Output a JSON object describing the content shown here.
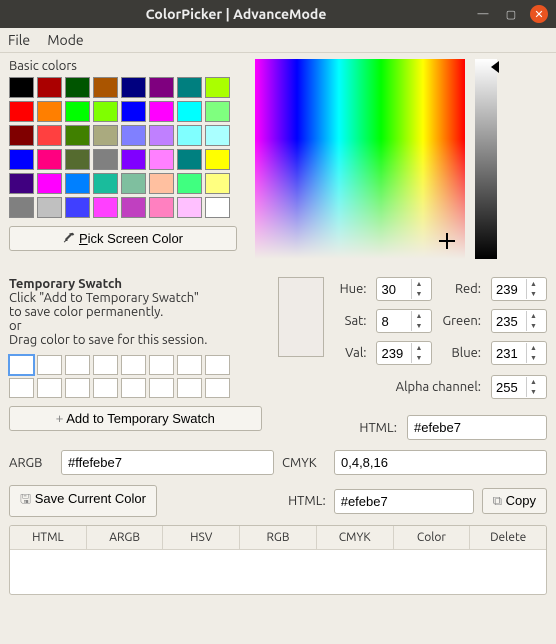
{
  "window": {
    "title": "ColorPicker | AdvanceMode"
  },
  "menu": {
    "file": "File",
    "mode": "Mode"
  },
  "basic_label": "Basic colors",
  "basic_colors": [
    "#000000",
    "#aa0000",
    "#005500",
    "#aa5500",
    "#00007f",
    "#7f007f",
    "#007f7f",
    "#aaff00",
    "#ff0000",
    "#ff7f00",
    "#00ff00",
    "#7fff00",
    "#0000ff",
    "#ff00ff",
    "#00ffff",
    "#7fff7f",
    "#800000",
    "#ff4040",
    "#408000",
    "#aaaa7f",
    "#8080ff",
    "#c080ff",
    "#80ffff",
    "#aaffff",
    "#0000ff",
    "#ff0080",
    "#556b2f",
    "#808080",
    "#8000ff",
    "#ff80ff",
    "#008080",
    "#ffff00",
    "#400080",
    "#ff00ff",
    "#0080ff",
    "#1abc9c",
    "#7fbf9f",
    "#ffc0a0",
    "#40ff80",
    "#ffff80",
    "#808080",
    "#c0c0c0",
    "#4040ff",
    "#ff40ff",
    "#c040c0",
    "#ff80c0",
    "#ffc0ff",
    "#ffffff"
  ],
  "pick_label_pre": "",
  "pick_label": "ick Screen Color",
  "pick_key": "P",
  "temp": {
    "heading": "Temporary Swatch",
    "line1": "Click \"Add to Temporary Swatch\"",
    "line2": "to save color permanently.",
    "line3": "or",
    "line4": "Drag color to save for this session.",
    "add_label": "Add to Temporary Swatch"
  },
  "labels": {
    "hue": "Hue:",
    "sat": "Sat:",
    "val": "Val:",
    "red": "Red:",
    "green": "Green:",
    "blue": "Blue:",
    "alpha": "Alpha channel:",
    "html": "HTML:",
    "argb": "ARGB",
    "cmyk": "CMYK",
    "save": "Save Current Color",
    "copy": "Copy"
  },
  "values": {
    "hue": "30",
    "sat": "8",
    "val": "239",
    "red": "239",
    "green": "235",
    "blue": "231",
    "alpha": "255",
    "html": "#efebe7",
    "argb": "#ffefebe7",
    "cmyk": "0,4,8,16",
    "html2": "#efebe7"
  },
  "table": {
    "cols": [
      "HTML",
      "ARGB",
      "HSV",
      "RGB",
      "CMYK",
      "Color",
      "Delete"
    ]
  }
}
